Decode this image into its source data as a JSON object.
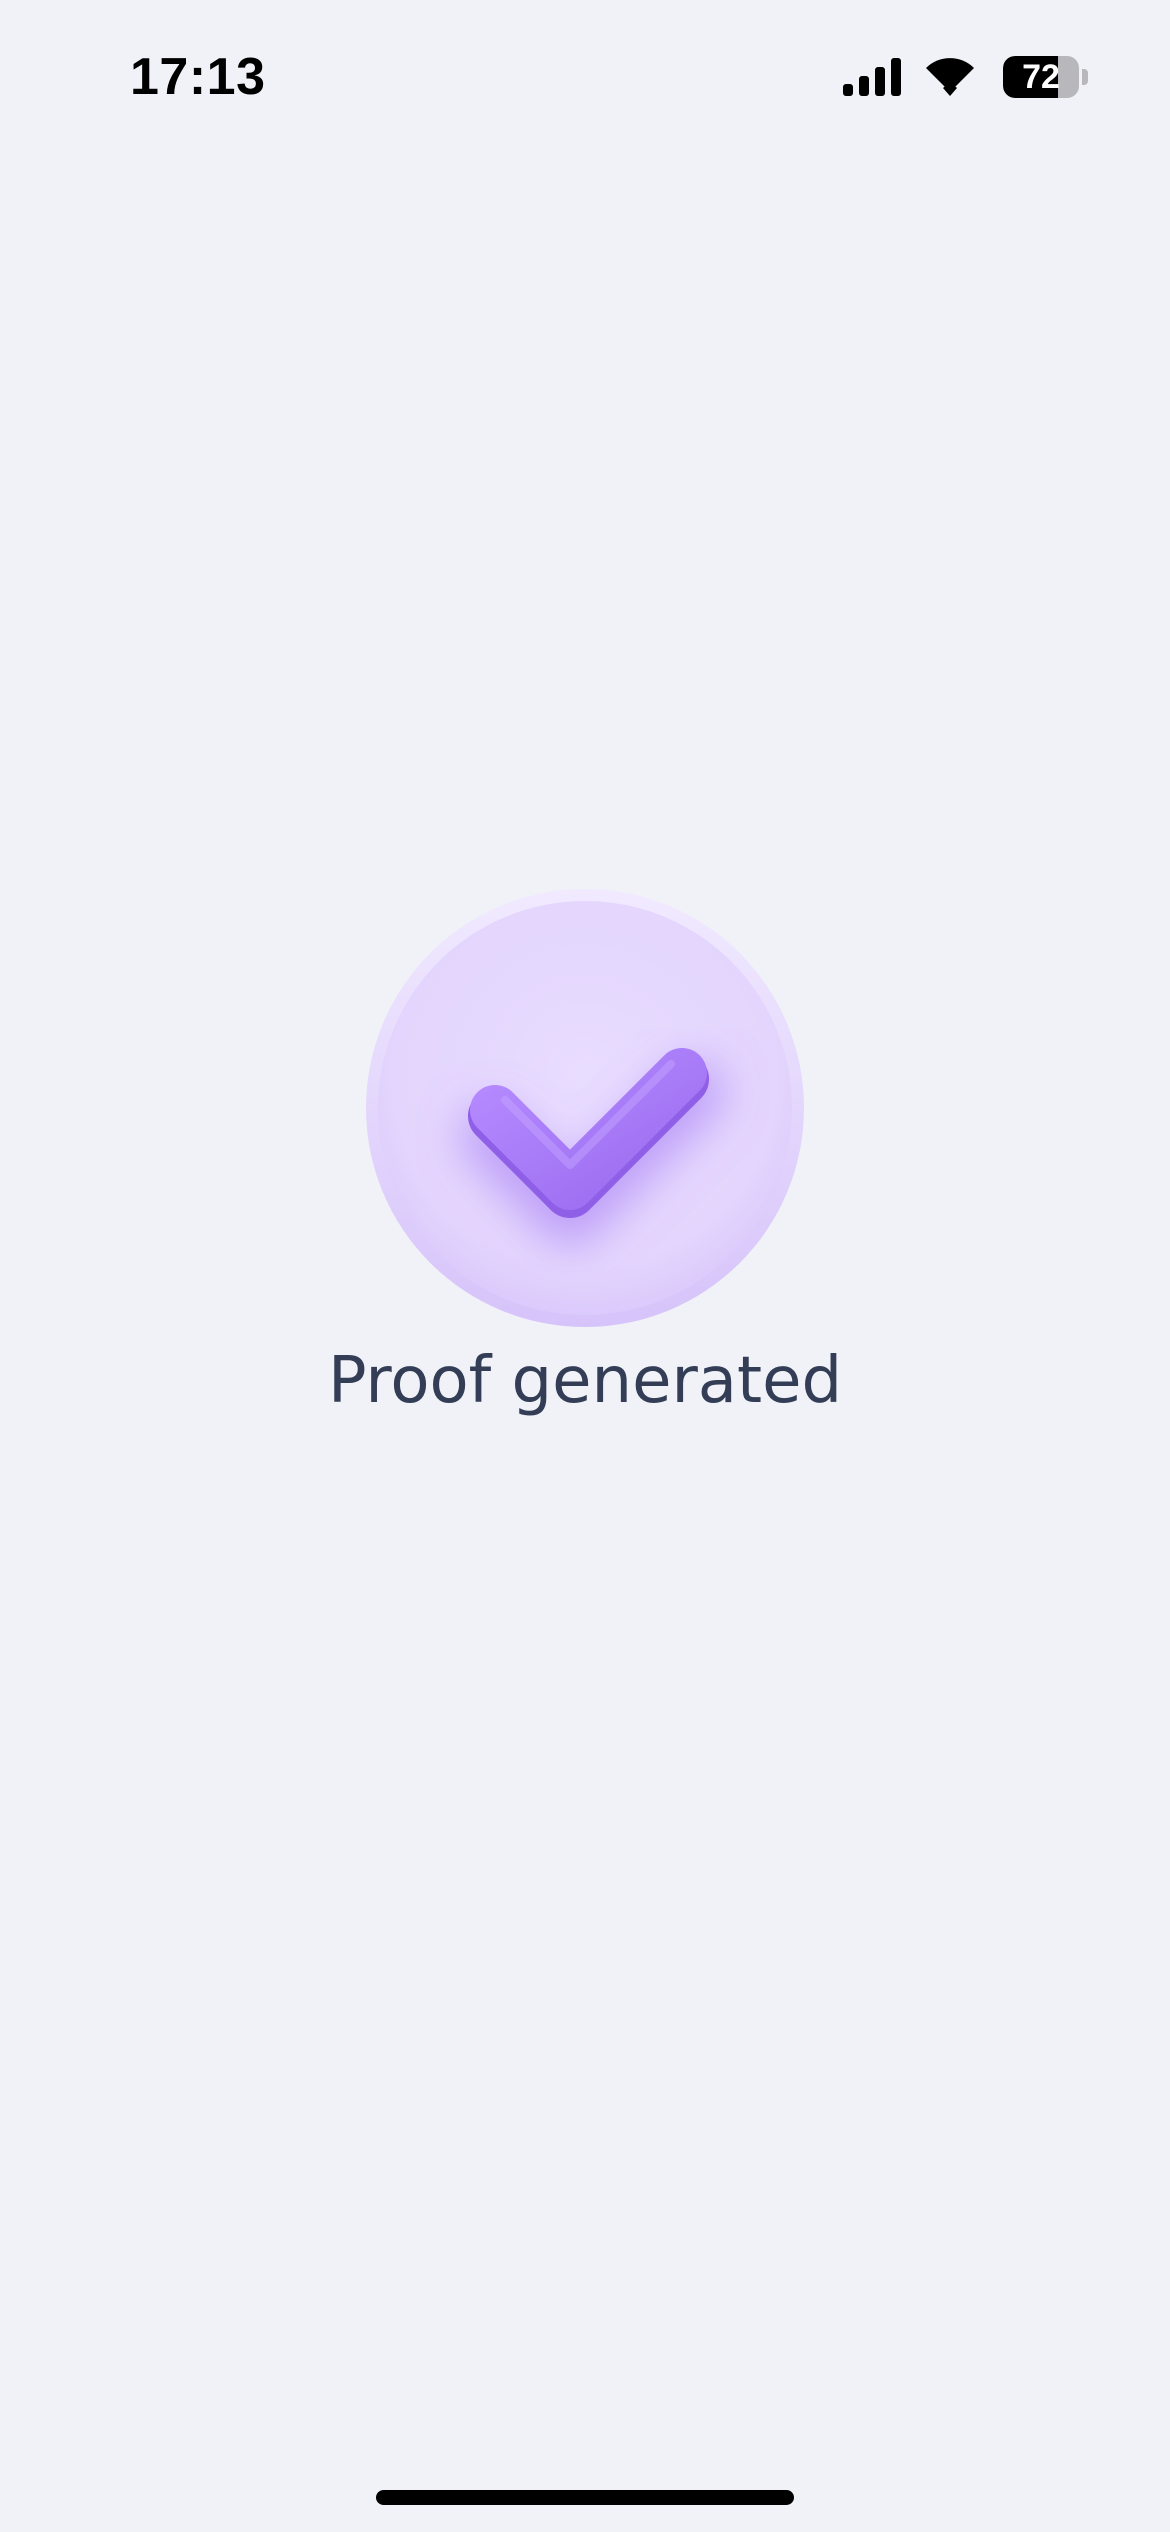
{
  "status_bar": {
    "time": "17:13",
    "battery_level": "72",
    "battery_fraction": 0.72,
    "signal_icon": "cellular-signal-icon",
    "wifi_icon": "wifi-icon",
    "battery_icon": "battery-icon"
  },
  "main": {
    "icon": "check-icon",
    "message": "Proof generated"
  },
  "colors": {
    "background": "#f0f2f7",
    "badge_fill": "#e6dafd",
    "check": "#a77cf5",
    "message_text": "#333d56"
  }
}
